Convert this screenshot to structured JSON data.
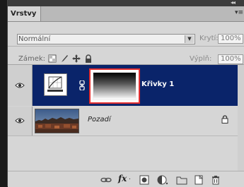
{
  "panel": {
    "tab_title": "Vrstvy",
    "collapse_glyph": "◂◂",
    "menu_glyph": "▾≡"
  },
  "blend": {
    "mode": "Normální",
    "opacity_label": "Krytí:",
    "opacity_value": "100%"
  },
  "lock": {
    "label": "Zámek:",
    "fill_label": "Výplň:",
    "fill_value": "100%"
  },
  "layers": [
    {
      "name": "Křivky 1",
      "type": "adjustment-curves",
      "selected": true,
      "visible": true
    },
    {
      "name": "Pozadí",
      "type": "background-image",
      "selected": false,
      "visible": true,
      "locked": true
    }
  ],
  "colors": {
    "selection": "#0a246a",
    "mask_highlight": "#e53030",
    "panel_bg": "#d6d6d6"
  },
  "toolbar": {
    "fx_label": "fx",
    "icons": [
      "link-layers-icon",
      "fx-icon",
      "add-mask-icon",
      "adjustment-layer-icon",
      "new-group-icon",
      "new-layer-icon",
      "trash-icon"
    ]
  }
}
